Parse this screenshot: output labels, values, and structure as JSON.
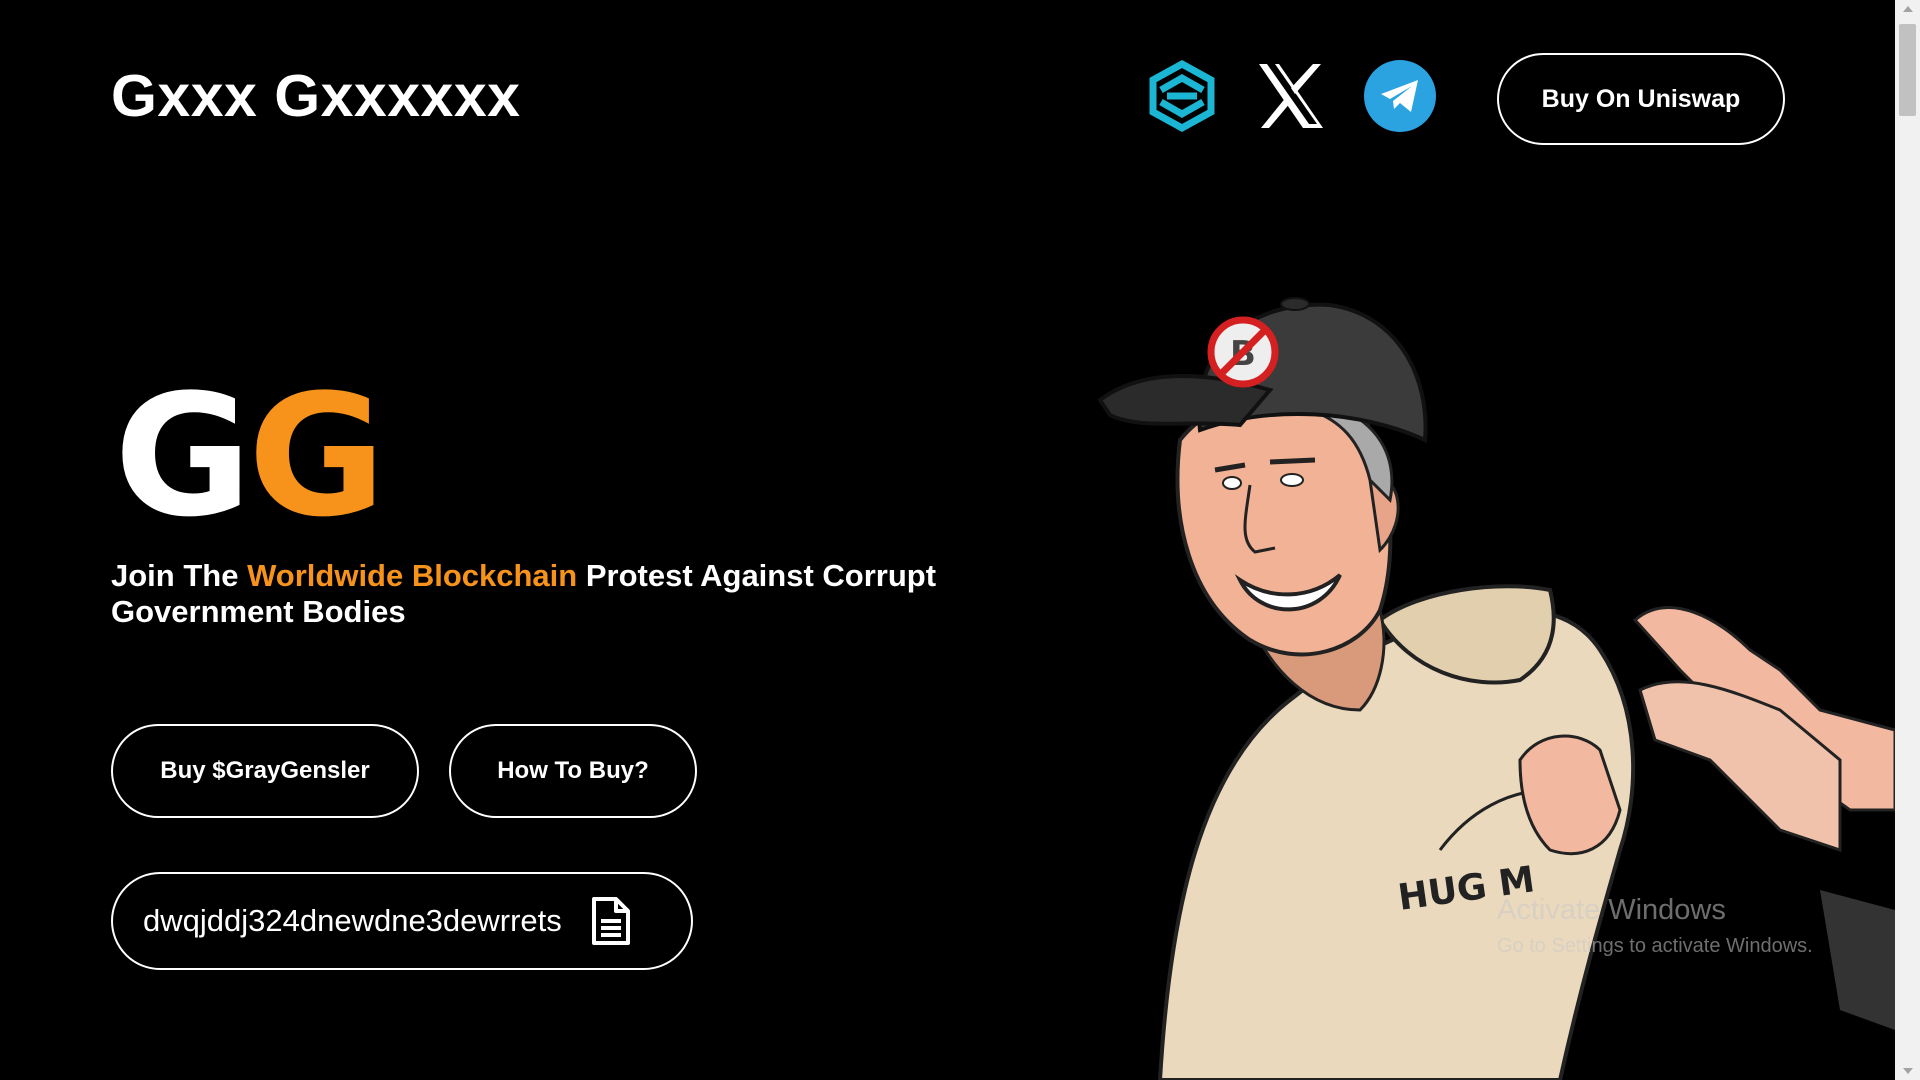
{
  "header": {
    "brand": "Gxxx Gxxxxxx",
    "icons": [
      "dextools-icon",
      "x-icon",
      "telegram-icon"
    ],
    "buy_uniswap_label": "Buy On Uniswap"
  },
  "hero": {
    "logo_letter_1": "G",
    "logo_letter_2": "G",
    "tagline_prefix": "Join The ",
    "tagline_accent": "Worldwide Blockchain",
    "tagline_suffix": " Protest Against Corrupt Government Bodies",
    "buy_label": "Buy $GrayGensler",
    "how_label": "How To Buy?",
    "contract_address": "dwqjddj324dnewdne3dewrrets",
    "hoodie_text": "HUG M"
  },
  "watermark": {
    "title": "Activate Windows",
    "subtitle": "Go to Settings to activate Windows."
  },
  "colors": {
    "background": "#000000",
    "accent": "#f7931a",
    "telegram": "#2aa3e0",
    "dextools": "#1bb6d4"
  }
}
